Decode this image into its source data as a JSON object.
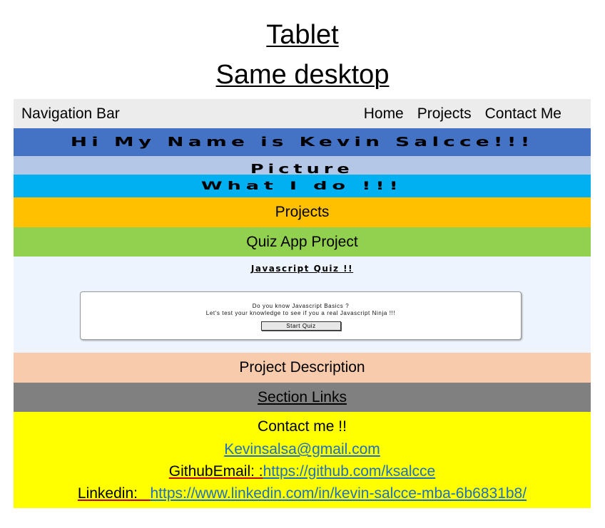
{
  "titles": {
    "line1": "Tablet",
    "line2": "Same desktop"
  },
  "nav": {
    "label": "Navigation Bar",
    "links": [
      "Home",
      "Projects",
      "Contact Me"
    ]
  },
  "sections": {
    "hero": "Hi My Name is Kevin Salcce!!!",
    "picture": "Picture",
    "what_i_do": "What I do !!!",
    "projects": "Projects",
    "quiz_app": "Quiz App Project",
    "description": "Project Description",
    "section_links": "Section Links"
  },
  "quiz_preview": {
    "title": "Javascript Quiz !!",
    "line1": "Do you know Javascript Basics ?",
    "line2": "Let's test your knowledge to see if you a real Javascript Ninja !!!",
    "button": "Start Quiz"
  },
  "contact": {
    "heading": "Contact me !!",
    "email": "Kevinsalsa@gmail.com",
    "github_label": "GithubEmail: :",
    "github_url": "https://github.com/ksalcce",
    "linkedin_label": "Linkedin:",
    "linkedin_url": "https://www.linkedin.com/in/kevin-salcce-mba-6b6831b8/"
  },
  "colors": {
    "nav": "#ececec",
    "hero": "#4472c4",
    "picture": "#b4c7e7",
    "what_i_do": "#00b0f0",
    "projects": "#ffc000",
    "quiz_app": "#92d050",
    "preview": "#eef4fd",
    "description": "#f8cbad",
    "section_links": "#808080",
    "contact": "#ffff00",
    "link": "#1f6fbf"
  }
}
